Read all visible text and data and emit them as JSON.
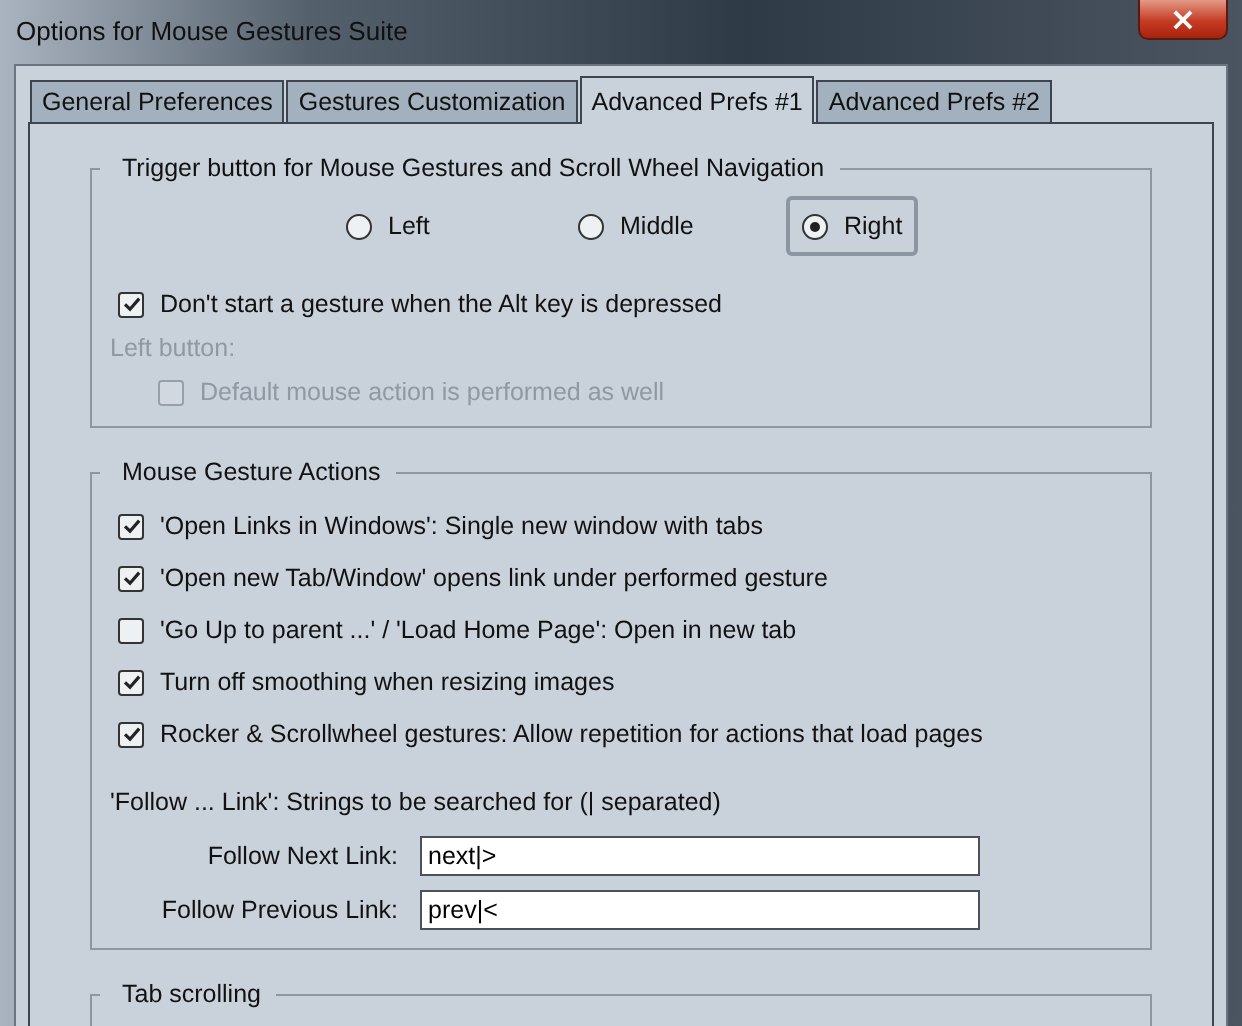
{
  "window": {
    "title": "Options for Mouse Gestures Suite",
    "close": "×"
  },
  "tabs": [
    {
      "label": "General Preferences",
      "selected": false
    },
    {
      "label": "Gestures Customization",
      "selected": false
    },
    {
      "label": "Advanced Prefs #1",
      "selected": true
    },
    {
      "label": "Advanced Prefs #2",
      "selected": false
    }
  ],
  "trigger_group": {
    "title": "Trigger button for Mouse Gestures and Scroll Wheel Navigation",
    "options": [
      {
        "label": "Left",
        "selected": false
      },
      {
        "label": "Middle",
        "selected": false
      },
      {
        "label": "Right",
        "selected": true
      }
    ],
    "alt_check": {
      "label": "Don't start a gesture when the Alt key is depressed",
      "checked": true,
      "disabled": false
    },
    "left_button_label": {
      "text": "Left button:",
      "disabled": true
    },
    "default_action_check": {
      "label": "Default mouse action is performed as well",
      "checked": false,
      "disabled": true
    }
  },
  "actions_group": {
    "title": "Mouse Gesture Actions",
    "checks": [
      {
        "label": "'Open Links in Windows': Single new window with tabs",
        "checked": true,
        "disabled": false
      },
      {
        "label": "'Open new Tab/Window' opens link under performed gesture",
        "checked": true,
        "disabled": false
      },
      {
        "label": "'Go Up to parent ...' / 'Load Home Page': Open in new tab",
        "checked": false,
        "disabled": false
      },
      {
        "label": "Turn off smoothing when resizing images",
        "checked": true,
        "disabled": false
      },
      {
        "label": "Rocker & Scrollwheel gestures: Allow repetition for actions that load pages",
        "checked": true,
        "disabled": false
      }
    ],
    "follow_note": "'Follow ... Link': Strings to be searched for (| separated)",
    "fields": [
      {
        "label": "Follow Next Link:",
        "value": "next|>"
      },
      {
        "label": "Follow Previous Link:",
        "value": "prev|<"
      }
    ]
  },
  "tab_scrolling_group": {
    "title": "Tab scrolling"
  }
}
